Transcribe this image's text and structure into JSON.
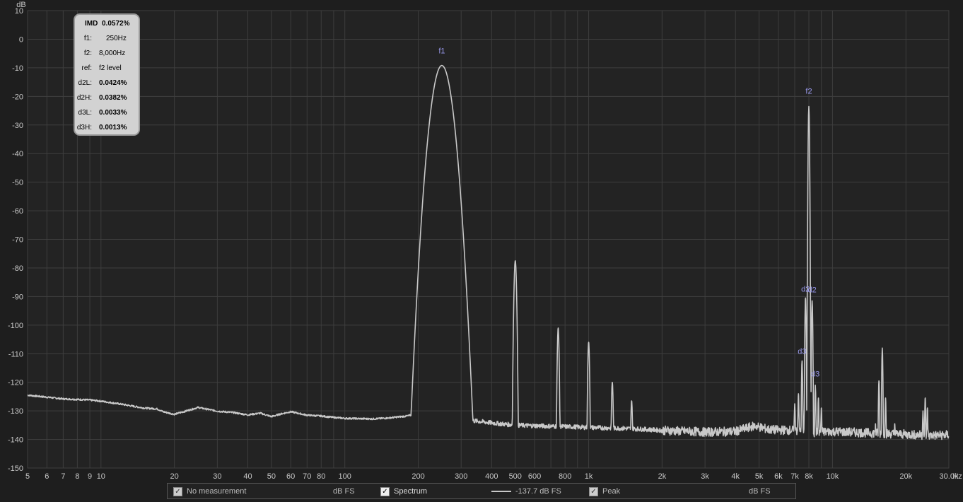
{
  "chart_data": {
    "type": "line",
    "ylabel": "dB",
    "xlabel": "Hz",
    "xscale": "log",
    "xlim": [
      5,
      30000
    ],
    "ylim": [
      -150,
      10
    ],
    "grid": true,
    "yticks": [
      10,
      0,
      -10,
      -20,
      -30,
      -40,
      -50,
      -60,
      -70,
      -80,
      -90,
      -100,
      -110,
      -120,
      -130,
      -140,
      -150
    ],
    "xticks": [
      {
        "v": 5,
        "label": "5"
      },
      {
        "v": 6,
        "label": "6"
      },
      {
        "v": 7,
        "label": "7"
      },
      {
        "v": 8,
        "label": "8"
      },
      {
        "v": 9,
        "label": "9"
      },
      {
        "v": 10,
        "label": "10"
      },
      {
        "v": 20,
        "label": "20"
      },
      {
        "v": 30,
        "label": "30"
      },
      {
        "v": 40,
        "label": "40"
      },
      {
        "v": 50,
        "label": "50"
      },
      {
        "v": 60,
        "label": "60"
      },
      {
        "v": 70,
        "label": "70"
      },
      {
        "v": 80,
        "label": "80"
      },
      {
        "v": 100,
        "label": "100"
      },
      {
        "v": 200,
        "label": "200"
      },
      {
        "v": 300,
        "label": "300"
      },
      {
        "v": 400,
        "label": "400"
      },
      {
        "v": 500,
        "label": "500"
      },
      {
        "v": 600,
        "label": "600"
      },
      {
        "v": 800,
        "label": "800"
      },
      {
        "v": 1000,
        "label": "1k"
      },
      {
        "v": 2000,
        "label": "2k"
      },
      {
        "v": 3000,
        "label": "3k"
      },
      {
        "v": 4000,
        "label": "4k"
      },
      {
        "v": 5000,
        "label": "5k"
      },
      {
        "v": 6000,
        "label": "6k"
      },
      {
        "v": 7000,
        "label": "7k"
      },
      {
        "v": 8000,
        "label": "8k"
      },
      {
        "v": 10000,
        "label": "10k"
      },
      {
        "v": 20000,
        "label": "20k"
      },
      {
        "v": 30000,
        "label": "30.0k"
      }
    ],
    "series": [
      {
        "color": "#c8c8c8",
        "floor": [
          [
            5,
            -124.5
          ],
          [
            6,
            -125.2
          ],
          [
            7,
            -125.8
          ],
          [
            8,
            -126
          ],
          [
            9,
            -126.2
          ],
          [
            10,
            -126.6
          ],
          [
            12,
            -127.6
          ],
          [
            15,
            -129
          ],
          [
            17,
            -129.3
          ],
          [
            18,
            -130.3
          ],
          [
            20,
            -131.2
          ],
          [
            22,
            -130.2
          ],
          [
            25,
            -128.8
          ],
          [
            28,
            -129.6
          ],
          [
            30,
            -130.1
          ],
          [
            35,
            -130.6
          ],
          [
            40,
            -131.4
          ],
          [
            45,
            -130.8
          ],
          [
            50,
            -132
          ],
          [
            55,
            -131
          ],
          [
            60,
            -130.3
          ],
          [
            70,
            -131.5
          ],
          [
            80,
            -131.8
          ],
          [
            90,
            -132.3
          ],
          [
            100,
            -132.6
          ],
          [
            130,
            -132.8
          ],
          [
            150,
            -132.5
          ],
          [
            180,
            -131.8
          ],
          [
            200,
            -131
          ],
          [
            225,
            -129.5
          ],
          [
            290,
            -133
          ],
          [
            350,
            -133.6
          ],
          [
            400,
            -134.2
          ],
          [
            500,
            -135
          ],
          [
            600,
            -135.2
          ],
          [
            800,
            -135.5
          ],
          [
            1000,
            -135.8
          ],
          [
            1500,
            -136.2
          ],
          [
            2000,
            -136.8
          ],
          [
            3000,
            -137.4
          ],
          [
            4000,
            -137.2
          ],
          [
            4800,
            -135.2
          ],
          [
            5500,
            -136.6
          ],
          [
            7000,
            -136.8
          ],
          [
            8000,
            -137.6
          ],
          [
            10000,
            -137.2
          ],
          [
            15000,
            -137.8
          ],
          [
            20000,
            -138.2
          ],
          [
            25000,
            -138.6
          ],
          [
            30000,
            -138.4
          ]
        ],
        "peaks": [
          {
            "f": 250,
            "db": -9.2,
            "w": 0.028
          },
          {
            "f": 500,
            "db": -77.5,
            "w": 0.004
          },
          {
            "f": 750,
            "db": -101,
            "w": 0.003
          },
          {
            "f": 1000,
            "db": -106,
            "w": 0.003
          },
          {
            "f": 1250,
            "db": -120,
            "w": 0.003
          },
          {
            "f": 1500,
            "db": -126.5,
            "w": 0.003
          },
          {
            "f": 7000,
            "db": -127.5,
            "w": 0.002
          },
          {
            "f": 7250,
            "db": -124,
            "w": 0.002
          },
          {
            "f": 7500,
            "db": -112.5,
            "w": 0.002
          },
          {
            "f": 7750,
            "db": -90.5,
            "w": 0.002
          },
          {
            "f": 8000,
            "db": -23.5,
            "w": 0.002
          },
          {
            "f": 8250,
            "db": -91.5,
            "w": 0.002
          },
          {
            "f": 8500,
            "db": -121,
            "w": 0.002
          },
          {
            "f": 8750,
            "db": -125.5,
            "w": 0.002
          },
          {
            "f": 9000,
            "db": -129,
            "w": 0.002
          },
          {
            "f": 15500,
            "db": -119.5,
            "w": 0.002
          },
          {
            "f": 16000,
            "db": -108,
            "w": 0.002
          },
          {
            "f": 16500,
            "db": -125.5,
            "w": 0.002
          },
          {
            "f": 15000,
            "db": -134.5,
            "w": 0.002
          },
          {
            "f": 18000,
            "db": -134.5,
            "w": 0.002
          },
          {
            "f": 23500,
            "db": -130,
            "w": 0.002
          },
          {
            "f": 24000,
            "db": -125.5,
            "w": 0.002
          },
          {
            "f": 24500,
            "db": -129,
            "w": 0.002
          }
        ]
      }
    ],
    "annotations": [
      {
        "text": "f1",
        "f": 250,
        "db": -5
      },
      {
        "text": "f2",
        "f": 8000,
        "db": -19
      },
      {
        "text": "d2",
        "f": 7750,
        "db": -88.3
      },
      {
        "text": "d2",
        "f": 8250,
        "db": -88.6
      },
      {
        "text": "d3",
        "f": 7500,
        "db": -110
      },
      {
        "text": "d3",
        "f": 8500,
        "db": -118
      }
    ]
  },
  "imd_box": {
    "rows": [
      {
        "key": "IMD",
        "value": "0.0572%",
        "bold": true,
        "combined": true
      },
      {
        "key": "f1:",
        "value": "250Hz"
      },
      {
        "key": "f2:",
        "value": "8,000Hz"
      },
      {
        "key": "ref:",
        "value": "f2 level"
      },
      {
        "key": "d2L:",
        "value": "0.0424%",
        "bold": true
      },
      {
        "key": "d2H:",
        "value": "0.0382%",
        "bold": true
      },
      {
        "key": "d3L:",
        "value": "0.0033%",
        "bold": true
      },
      {
        "key": "d3H:",
        "value": "0.0013%",
        "bold": true
      }
    ]
  },
  "legend": {
    "no_measurement": "No measurement",
    "unit1": "dB FS",
    "spectrum": "Spectrum",
    "spectrum_value": "-137.7 dB FS",
    "peak": "Peak",
    "unit2": "dB FS",
    "check": "✓"
  }
}
